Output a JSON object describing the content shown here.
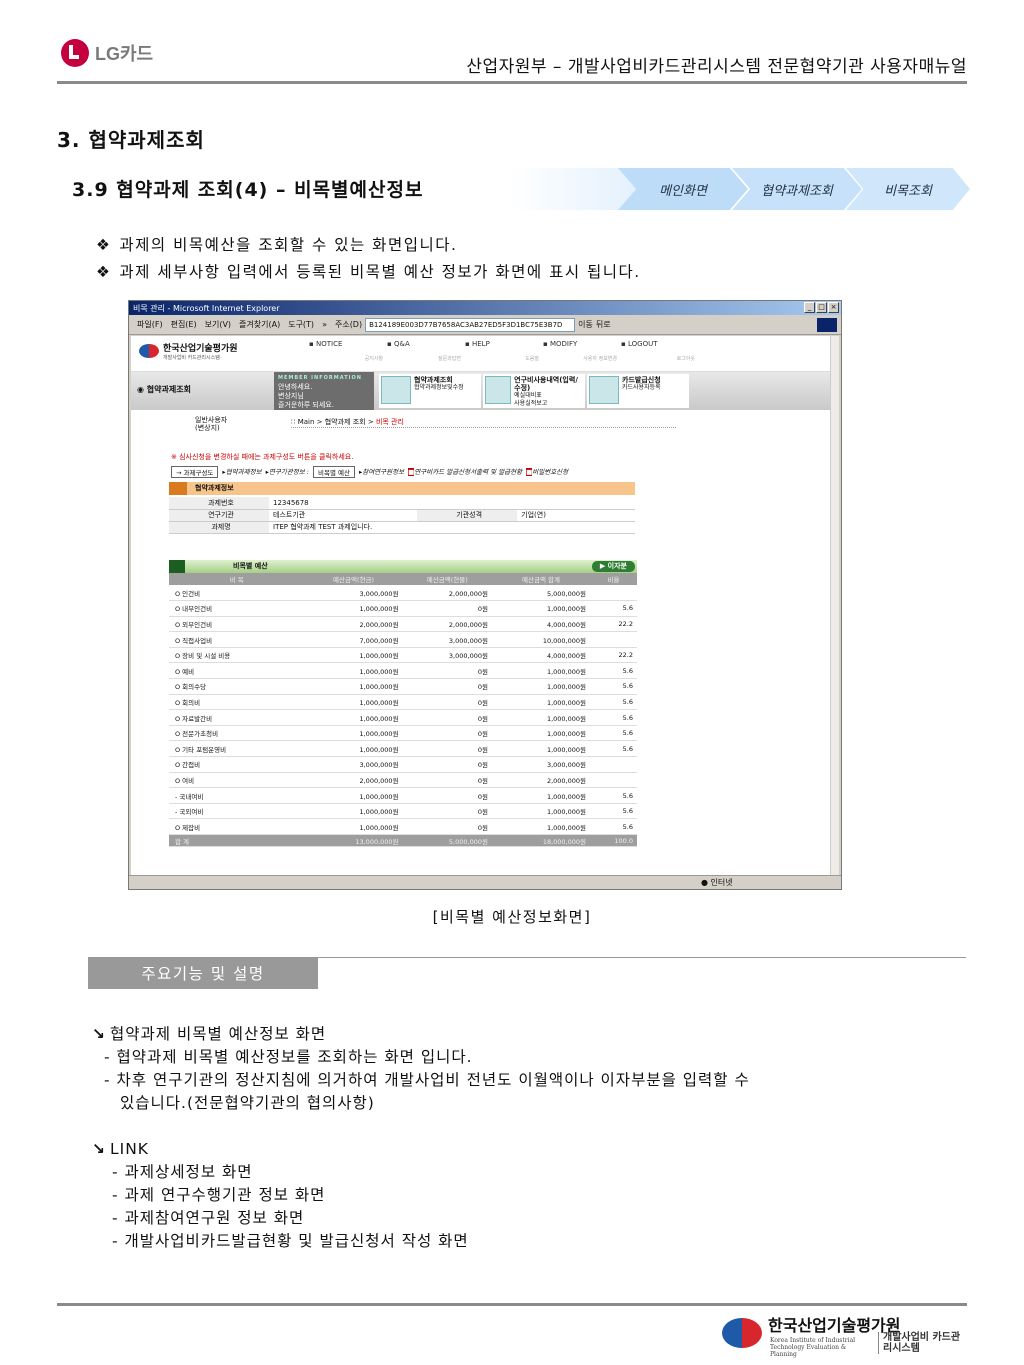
{
  "header": {
    "logo_text": "LG카드",
    "title": "산업자원부 – 개발사업비카드관리시스템 전문협약기관 사용자매뉴얼"
  },
  "section_title": "3. 협약과제조회",
  "subsection_title": "3.9 협약과제 조회(4) – 비목별예산정보",
  "breadcrumb": [
    "메인화면",
    "협약과제조회",
    "비목조회"
  ],
  "bullets": [
    "과제의 비목예산을 조회할 수 있는 화면입니다.",
    "과제 세부사항 입력에서 등록된 비목별 예산 정보가 화면에 표시 됩니다."
  ],
  "bullet_icon": "❖",
  "screenshot": {
    "window_title": "비목 관리 - Microsoft Internet Explorer",
    "menu": [
      "파일(F)",
      "편집(E)",
      "보기(V)",
      "즐겨찾기(A)",
      "도구(T)",
      "»"
    ],
    "address_label": "주소(D)",
    "address_value": "B124189E003D77B7658AC3AB27ED5F3D1BC75E3B7D",
    "go_label": "이동",
    "back_label": "뒤로",
    "site": {
      "logo_name": "한국산업기술평가원",
      "logo_sub": "Korea Institute of Industrial Technology Evaluation & Planning",
      "logo_system": "개발사업비 카드관리시스템",
      "topnav": [
        {
          "label": "NOTICE",
          "sub": "공지사항"
        },
        {
          "label": "Q&A",
          "sub": "질문과답변"
        },
        {
          "label": "HELP",
          "sub": "도움말"
        },
        {
          "label": "MODIFY",
          "sub": "사용자 정보변경"
        },
        {
          "label": "LOGOUT",
          "sub": "로그아웃"
        }
      ],
      "side_title": "협약과제조회",
      "member_heading": "MEMBER INFORMATION",
      "member_lines": [
        "안녕하세요.",
        "변상지님",
        "즐거운하루 되세요."
      ],
      "quick": [
        {
          "title": "협약과제조회",
          "lines": [
            "협약과제정보및수정"
          ]
        },
        {
          "title": "연구비사용내역(입력/수정)",
          "lines": [
            "예실대비표",
            "사용실적보고"
          ]
        },
        {
          "title": "카드발급신청",
          "lines": [
            "카드사용자등록"
          ]
        }
      ],
      "user_lines": [
        "일반사용자",
        "(변상지)"
      ],
      "path": [
        "Main",
        "협약과제 조회",
        "비목 관리"
      ],
      "notice": "※ 심사신청을 변경하실 때에는 과제구성도 버튼을 클릭하세요.",
      "tab_button": "→ 과제구성도",
      "tabs": [
        "협약과제정보",
        "연구기관정보 :",
        "비목별 예산",
        "참여연구원정보",
        "연구비카드 발급신청서출력 및 발급현황",
        "비밀번호신청"
      ],
      "info_heading": "협약과제정보",
      "info": {
        "task_no_label": "과제번호",
        "task_no": "12345678",
        "org_label": "연구기관",
        "org": "테스트기관",
        "org_type_label": "기관성격",
        "org_type": "기업(연)",
        "task_name_label": "과제명",
        "task_name": "ITEP 협약과제 TEST 과제입니다."
      },
      "budget_heading": "비목별 예산",
      "interest_button": "이자분",
      "budget_columns": [
        "비 목",
        "예산금액(현금)",
        "예산금액(현물)",
        "예산금액 합계",
        "비율"
      ],
      "budget_rows": [
        {
          "name": "O 인건비",
          "cash": "3,000,000원",
          "kind": "2,000,000원",
          "total": "5,000,000원",
          "ratio": ""
        },
        {
          "name": "O 내부인건비",
          "cash": "1,000,000원",
          "kind": "0원",
          "total": "1,000,000원",
          "ratio": "5.6"
        },
        {
          "name": "O 외부인건비",
          "cash": "2,000,000원",
          "kind": "2,000,000원",
          "total": "4,000,000원",
          "ratio": "22.2"
        },
        {
          "name": "O 직접사업비",
          "cash": "7,000,000원",
          "kind": "3,000,000원",
          "total": "10,000,000원",
          "ratio": ""
        },
        {
          "name": "O 장비 및 시설 비용",
          "cash": "1,000,000원",
          "kind": "3,000,000원",
          "total": "4,000,000원",
          "ratio": "22.2"
        },
        {
          "name": "O 예비",
          "cash": "1,000,000원",
          "kind": "0원",
          "total": "1,000,000원",
          "ratio": "5.6"
        },
        {
          "name": "O 회의수당",
          "cash": "1,000,000원",
          "kind": "0원",
          "total": "1,000,000원",
          "ratio": "5.6"
        },
        {
          "name": "O 회의비",
          "cash": "1,000,000원",
          "kind": "0원",
          "total": "1,000,000원",
          "ratio": "5.6"
        },
        {
          "name": "O 자료발간비",
          "cash": "1,000,000원",
          "kind": "0원",
          "total": "1,000,000원",
          "ratio": "5.6"
        },
        {
          "name": "O 전문가초청비",
          "cash": "1,000,000원",
          "kind": "0원",
          "total": "1,000,000원",
          "ratio": "5.6"
        },
        {
          "name": "O 기타 포럼운영비",
          "cash": "1,000,000원",
          "kind": "0원",
          "total": "1,000,000원",
          "ratio": "5.6"
        },
        {
          "name": "O 간접비",
          "cash": "3,000,000원",
          "kind": "0원",
          "total": "3,000,000원",
          "ratio": ""
        },
        {
          "name": "O 여비",
          "cash": "2,000,000원",
          "kind": "0원",
          "total": "2,000,000원",
          "ratio": ""
        },
        {
          "name": "- 국내여비",
          "cash": "1,000,000원",
          "kind": "0원",
          "total": "1,000,000원",
          "ratio": "5.6"
        },
        {
          "name": "- 국외여비",
          "cash": "1,000,000원",
          "kind": "0원",
          "total": "1,000,000원",
          "ratio": "5.6"
        },
        {
          "name": "O 제잡비",
          "cash": "1,000,000원",
          "kind": "0원",
          "total": "1,000,000원",
          "ratio": "5.6"
        }
      ],
      "budget_total": {
        "name": "합 계",
        "cash": "13,000,000원",
        "kind": "5,000,000원",
        "total": "18,000,000원",
        "ratio": "100.0"
      },
      "status_zone": "인터넷"
    }
  },
  "caption": "[비목별 예산정보화면]",
  "function_tab": "주요기능 및 설명",
  "desc": {
    "arrow": "↘",
    "h1": "협약과제 비목별 예산정보 화면",
    "l1": "- 협약과제 비목별 예산정보를 조회하는 화면 입니다.",
    "l2": "- 차후 연구기관의 정산지침에 의거하여 개발사업비 전년도 이월액이나 이자부분을 입력할 수",
    "l3": "있습니다.(전문협약기관의 협의사항)",
    "h2": "LINK",
    "links": [
      "- 과제상세정보 화면",
      "- 과제 연구수행기관 정보 화면",
      "- 과제참여연구원 정보 화면",
      "- 개발사업비카드발급현황 및 발급신청서 작성 화면"
    ]
  },
  "footer": {
    "name": "한국산업기술평가원",
    "sub": "Korea Institute of Industrial Technology Evaluation & Planning",
    "system": "개발사업비 카드관리시스템"
  }
}
